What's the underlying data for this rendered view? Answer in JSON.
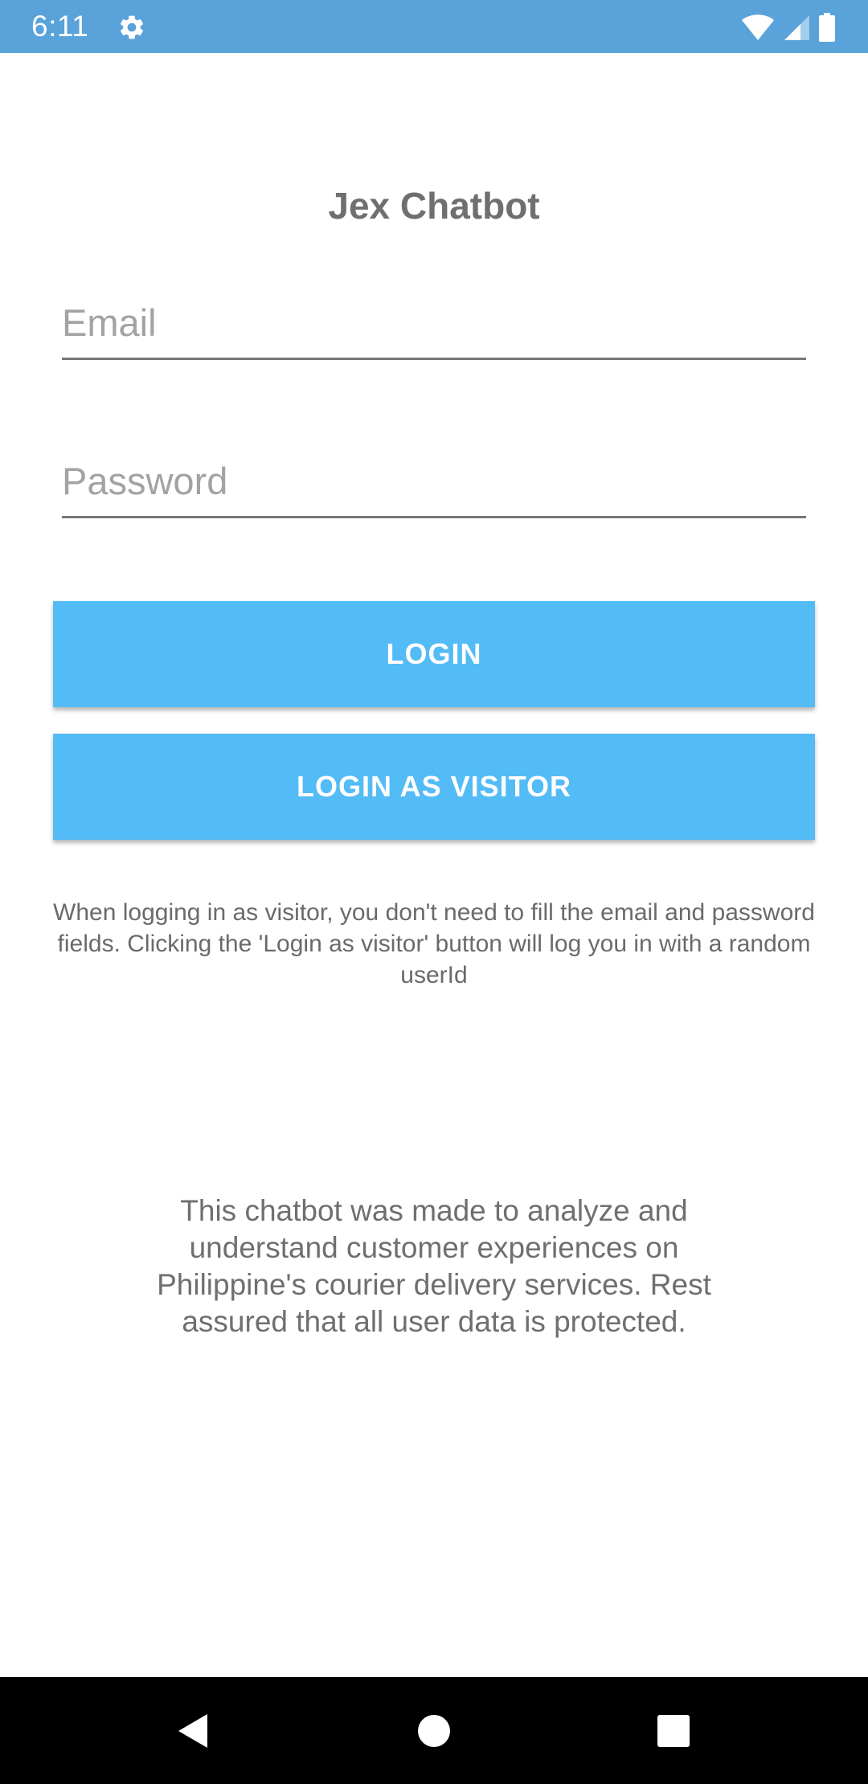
{
  "status_bar": {
    "time": "6:11",
    "left_icons": [
      "gear-icon"
    ],
    "right_icons": [
      "wifi-icon",
      "cellular-signal-icon",
      "battery-icon"
    ]
  },
  "app": {
    "title": "Jex Chatbot"
  },
  "form": {
    "email_placeholder": "Email",
    "email_value": "",
    "password_placeholder": "Password",
    "password_value": ""
  },
  "buttons": {
    "login_label": "LOGIN",
    "visitor_label": "LOGIN AS VISITOR"
  },
  "notes": {
    "visitor_note": "When logging in as visitor, you don't need to fill the email and password fields. Clicking the 'Login as visitor' button will log you in with a random userId",
    "about": "This chatbot was made to analyze and understand customer experiences on Philippine's courier delivery services. Rest assured that all user data is protected."
  },
  "nav_bar": {
    "icons": [
      "back-icon",
      "home-icon",
      "recents-icon"
    ]
  },
  "colors": {
    "status_bar": "#5aa2da",
    "button": "#53bbf5",
    "title_text": "#6f6f6f",
    "nav_bar": "#000000"
  }
}
